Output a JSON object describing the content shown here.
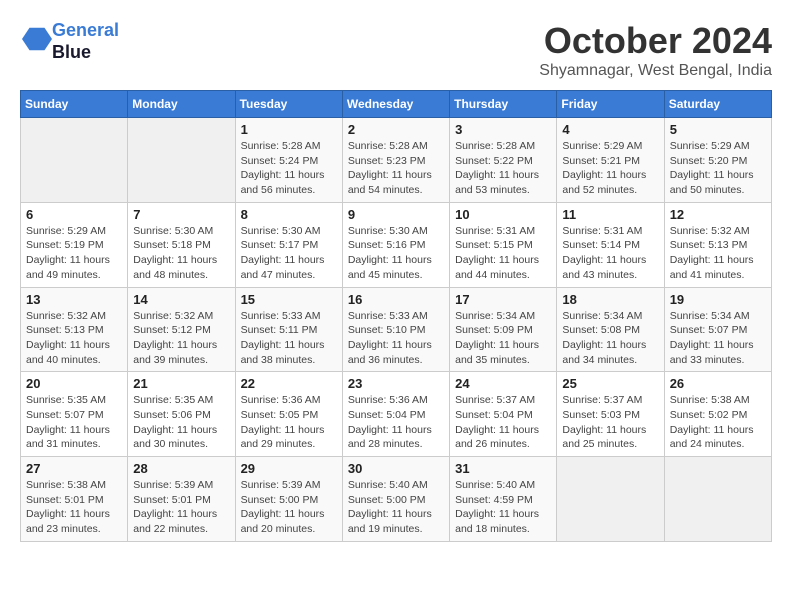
{
  "header": {
    "logo_line1": "General",
    "logo_line2": "Blue",
    "month_title": "October 2024",
    "subtitle": "Shyamnagar, West Bengal, India"
  },
  "days_of_week": [
    "Sunday",
    "Monday",
    "Tuesday",
    "Wednesday",
    "Thursday",
    "Friday",
    "Saturday"
  ],
  "weeks": [
    [
      {
        "day": "",
        "content": ""
      },
      {
        "day": "",
        "content": ""
      },
      {
        "day": "1",
        "content": "Sunrise: 5:28 AM\nSunset: 5:24 PM\nDaylight: 11 hours and 56 minutes."
      },
      {
        "day": "2",
        "content": "Sunrise: 5:28 AM\nSunset: 5:23 PM\nDaylight: 11 hours and 54 minutes."
      },
      {
        "day": "3",
        "content": "Sunrise: 5:28 AM\nSunset: 5:22 PM\nDaylight: 11 hours and 53 minutes."
      },
      {
        "day": "4",
        "content": "Sunrise: 5:29 AM\nSunset: 5:21 PM\nDaylight: 11 hours and 52 minutes."
      },
      {
        "day": "5",
        "content": "Sunrise: 5:29 AM\nSunset: 5:20 PM\nDaylight: 11 hours and 50 minutes."
      }
    ],
    [
      {
        "day": "6",
        "content": "Sunrise: 5:29 AM\nSunset: 5:19 PM\nDaylight: 11 hours and 49 minutes."
      },
      {
        "day": "7",
        "content": "Sunrise: 5:30 AM\nSunset: 5:18 PM\nDaylight: 11 hours and 48 minutes."
      },
      {
        "day": "8",
        "content": "Sunrise: 5:30 AM\nSunset: 5:17 PM\nDaylight: 11 hours and 47 minutes."
      },
      {
        "day": "9",
        "content": "Sunrise: 5:30 AM\nSunset: 5:16 PM\nDaylight: 11 hours and 45 minutes."
      },
      {
        "day": "10",
        "content": "Sunrise: 5:31 AM\nSunset: 5:15 PM\nDaylight: 11 hours and 44 minutes."
      },
      {
        "day": "11",
        "content": "Sunrise: 5:31 AM\nSunset: 5:14 PM\nDaylight: 11 hours and 43 minutes."
      },
      {
        "day": "12",
        "content": "Sunrise: 5:32 AM\nSunset: 5:13 PM\nDaylight: 11 hours and 41 minutes."
      }
    ],
    [
      {
        "day": "13",
        "content": "Sunrise: 5:32 AM\nSunset: 5:13 PM\nDaylight: 11 hours and 40 minutes."
      },
      {
        "day": "14",
        "content": "Sunrise: 5:32 AM\nSunset: 5:12 PM\nDaylight: 11 hours and 39 minutes."
      },
      {
        "day": "15",
        "content": "Sunrise: 5:33 AM\nSunset: 5:11 PM\nDaylight: 11 hours and 38 minutes."
      },
      {
        "day": "16",
        "content": "Sunrise: 5:33 AM\nSunset: 5:10 PM\nDaylight: 11 hours and 36 minutes."
      },
      {
        "day": "17",
        "content": "Sunrise: 5:34 AM\nSunset: 5:09 PM\nDaylight: 11 hours and 35 minutes."
      },
      {
        "day": "18",
        "content": "Sunrise: 5:34 AM\nSunset: 5:08 PM\nDaylight: 11 hours and 34 minutes."
      },
      {
        "day": "19",
        "content": "Sunrise: 5:34 AM\nSunset: 5:07 PM\nDaylight: 11 hours and 33 minutes."
      }
    ],
    [
      {
        "day": "20",
        "content": "Sunrise: 5:35 AM\nSunset: 5:07 PM\nDaylight: 11 hours and 31 minutes."
      },
      {
        "day": "21",
        "content": "Sunrise: 5:35 AM\nSunset: 5:06 PM\nDaylight: 11 hours and 30 minutes."
      },
      {
        "day": "22",
        "content": "Sunrise: 5:36 AM\nSunset: 5:05 PM\nDaylight: 11 hours and 29 minutes."
      },
      {
        "day": "23",
        "content": "Sunrise: 5:36 AM\nSunset: 5:04 PM\nDaylight: 11 hours and 28 minutes."
      },
      {
        "day": "24",
        "content": "Sunrise: 5:37 AM\nSunset: 5:04 PM\nDaylight: 11 hours and 26 minutes."
      },
      {
        "day": "25",
        "content": "Sunrise: 5:37 AM\nSunset: 5:03 PM\nDaylight: 11 hours and 25 minutes."
      },
      {
        "day": "26",
        "content": "Sunrise: 5:38 AM\nSunset: 5:02 PM\nDaylight: 11 hours and 24 minutes."
      }
    ],
    [
      {
        "day": "27",
        "content": "Sunrise: 5:38 AM\nSunset: 5:01 PM\nDaylight: 11 hours and 23 minutes."
      },
      {
        "day": "28",
        "content": "Sunrise: 5:39 AM\nSunset: 5:01 PM\nDaylight: 11 hours and 22 minutes."
      },
      {
        "day": "29",
        "content": "Sunrise: 5:39 AM\nSunset: 5:00 PM\nDaylight: 11 hours and 20 minutes."
      },
      {
        "day": "30",
        "content": "Sunrise: 5:40 AM\nSunset: 5:00 PM\nDaylight: 11 hours and 19 minutes."
      },
      {
        "day": "31",
        "content": "Sunrise: 5:40 AM\nSunset: 4:59 PM\nDaylight: 11 hours and 18 minutes."
      },
      {
        "day": "",
        "content": ""
      },
      {
        "day": "",
        "content": ""
      }
    ]
  ]
}
